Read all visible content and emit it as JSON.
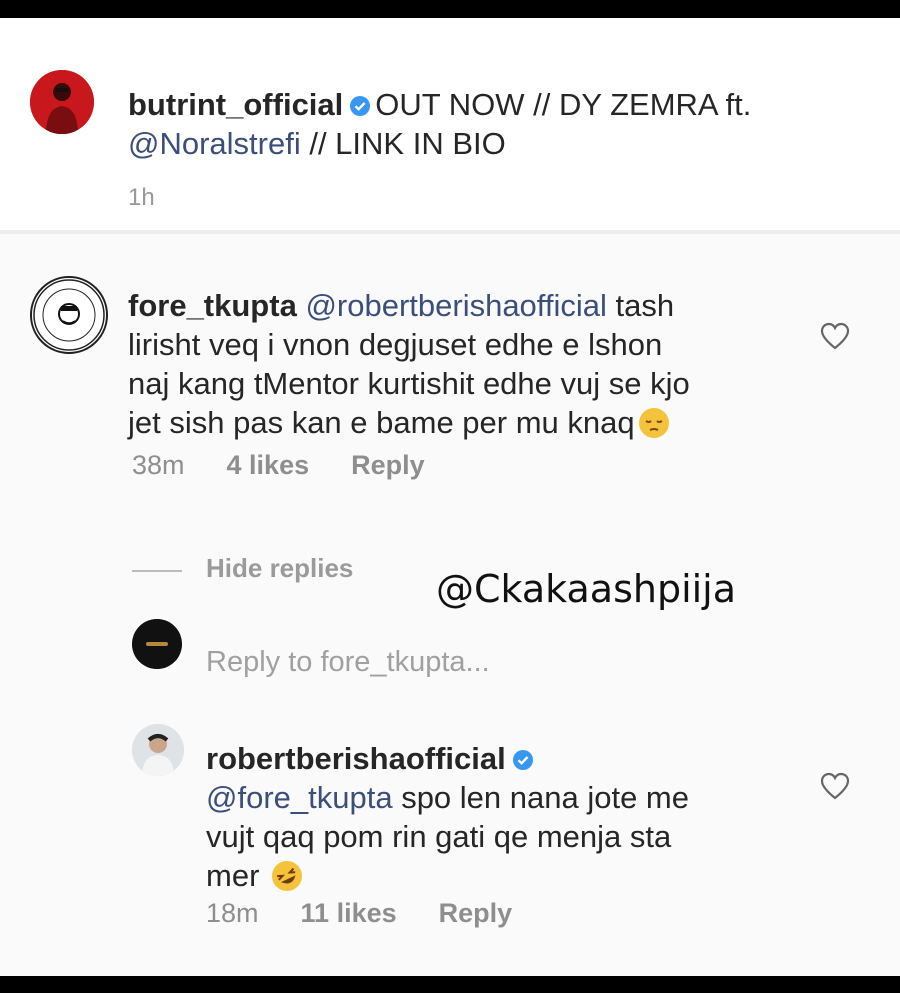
{
  "post": {
    "username": "butrint_official",
    "caption_part1": "OUT NOW // DY ZEMRA ft.",
    "caption_mention": "@Noralstrefi",
    "caption_part2": " // LINK IN BIO",
    "time": "1h"
  },
  "comments": [
    {
      "username": "fore_tkupta",
      "mention": "@robertberishaofficial",
      "line1_rest": " tash",
      "line2": "lirisht veq i vnon degjuset edhe e lshon",
      "line3": "naj kang tMentor kurtishit edhe vuj se kjo",
      "line4": "jet sish pas kan e bame per mu knaq",
      "time": "38m",
      "likes": "4 likes",
      "reply_label": "Reply"
    }
  ],
  "replies": {
    "hide_label": "Hide replies",
    "input_placeholder": "Reply to fore_tkupta...",
    "items": [
      {
        "username": "robertberishaofficial",
        "mention": "@fore_tkupta",
        "line1_rest": " spo len nana jote me",
        "line2": "vujt qaq pom rin gati qe menja sta",
        "line3": "mer",
        "time": "18m",
        "likes": "11 likes",
        "reply_label": "Reply"
      }
    ]
  },
  "watermark": "@Ckakaashpiija",
  "icons": {
    "verified": "verified-badge-icon",
    "like": "heart-outline-icon",
    "emoji_pensive": "pensive-face-emoji",
    "emoji_laughing": "rolling-laughing-emoji"
  },
  "colors": {
    "verified": "#3897f0",
    "mention": "#3b4f7a",
    "meta": "#8e8e8e",
    "avatar_butrint": "#c8181e"
  }
}
